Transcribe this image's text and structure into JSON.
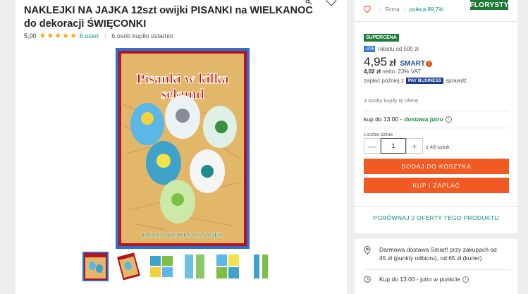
{
  "product": {
    "title": "NAKLEJKI NA JAJKA 12szt owijki PISANKI na WIELKANOC do dekoracji ŚWIĘCONKI",
    "rating": "5,00",
    "stars": 5,
    "reviews": "6 ocen",
    "bought_recently": "6 osób kupiło ostatnio",
    "package_title_line1": "Pisanki w kilka",
    "package_title_line2": "sekund",
    "package_bottom": "RAMKA OWIJKI NA 12 JAJEK"
  },
  "seller": {
    "type": "Firma",
    "recommend": "poleca 99,7%",
    "brand": "FLORYSTY"
  },
  "offer": {
    "supercena": "SUPERCENA",
    "discount_badge": "-2%",
    "discount_text": "rabatu od 500 zł",
    "price_main": "4,95",
    "price_currency": "zł",
    "smart_label": "SMART",
    "smart_bang": "!",
    "netto_price": "4,02 zł",
    "netto_text": " netto, 23% VAT",
    "pay_later_prefix": "zapłać później z",
    "pay_business": "PAY BUSINESS",
    "pay_later_suffix": "sprawdź",
    "bought_offer": "3 osoby kupiły tę ofertę",
    "delivery_prefix": "kup do 13:00 -",
    "delivery_green": "dostawa jutro",
    "qty_label": "Liczba sztuk",
    "qty_value": "1",
    "qty_of": "z 48 sztuk",
    "add_to_cart": "DODAJ DO KOSZYKA",
    "buy_now": "KUP I ZAPŁAĆ",
    "compare": "PORÓWNAJ 2 OFERTY TEGO PRODUKTU"
  },
  "shipping": {
    "free_shipping": "Darmowa dostawa Smart! przy zakupach od 45 zł (punkty odbioru), od 65 zł (kurier)",
    "pickup": "Kup do 13:00 - jutro w punkcie"
  },
  "colors": {
    "accent": "#f15a22",
    "teal": "#0d8a86",
    "brand_green": "#1c7a36"
  }
}
